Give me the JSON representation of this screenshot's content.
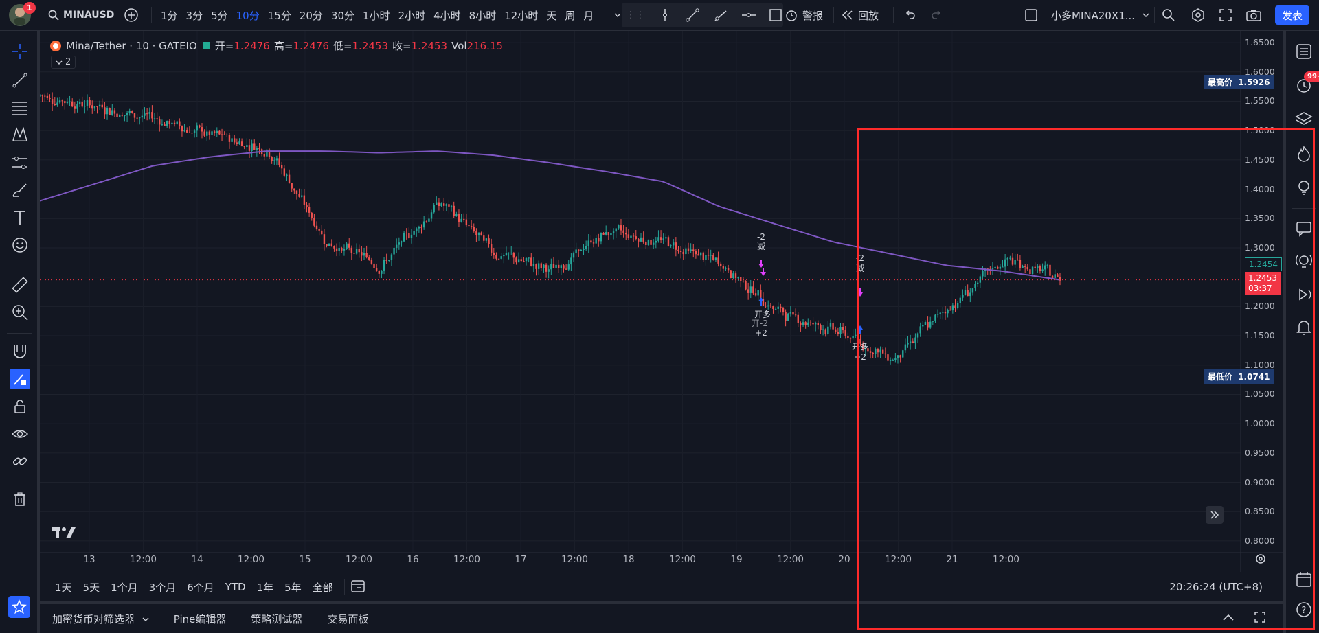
{
  "topbar": {
    "notif_count": "1",
    "symbol": "MINAUSD",
    "intervals": [
      "1分",
      "3分",
      "5分",
      "10分",
      "15分",
      "20分",
      "30分",
      "1小时",
      "2小时",
      "4小时",
      "8小时",
      "12小时",
      "天",
      "周",
      "月"
    ],
    "active_interval": "10分",
    "alert_label": "警报",
    "replay_label": "回放",
    "layout_name": "小多MINA20X1...",
    "publish_label": "发表"
  },
  "legend": {
    "title": "Mina/Tether · 10 · GATEIO",
    "open_label": "开=",
    "open": "1.2476",
    "high_label": "高=",
    "high": "1.2476",
    "low_label": "低=",
    "low": "1.2453",
    "close_label": "收=",
    "close": "1.2453",
    "vol_label": "Vol",
    "vol": "216.15",
    "indicator_count": "2"
  },
  "price_axis": {
    "ticks": [
      "1.6500",
      "1.6000",
      "1.5500",
      "1.5000",
      "1.4500",
      "1.4000",
      "1.3500",
      "1.3000",
      "1.2500",
      "1.2000",
      "1.1500",
      "1.1000",
      "1.0500",
      "1.0000",
      "0.9500",
      "0.9000",
      "0.8500",
      "0.8000"
    ],
    "high_label": "最高价",
    "high_value": "1.5926",
    "low_label": "最低价",
    "low_value": "1.0741",
    "ma_value": "1.2454",
    "last_price": "1.2453",
    "countdown": "03:37"
  },
  "time_axis": {
    "ticks": [
      "13",
      "12:00",
      "14",
      "12:00",
      "15",
      "12:00",
      "16",
      "12:00",
      "17",
      "12:00",
      "18",
      "12:00",
      "19",
      "12:00",
      "20",
      "12:00",
      "21",
      "12:00"
    ]
  },
  "signals": {
    "reduce_1_a": "-2",
    "reduce_1_b": "减",
    "open_1_a": "开多",
    "open_1_b": "开-2",
    "open_1_c": "+2",
    "reduce_2_a": "-2",
    "reduce_2_b": "减",
    "open_2_a": "开多",
    "open_2_b": "+2"
  },
  "bottom": {
    "ranges": [
      "1天",
      "5天",
      "1个月",
      "3个月",
      "6个月",
      "YTD",
      "1年",
      "5年",
      "全部"
    ],
    "clock": "20:26:24 (UTC+8)"
  },
  "panels": [
    "加密货币对筛选器",
    "Pine编辑器",
    "策略测试器",
    "交易面板"
  ],
  "right_badge": "99+",
  "colors": {
    "bg": "#131722",
    "up": "#26a69a",
    "down": "#ef5350",
    "ma": "#7e57c2",
    "accent": "#2962ff",
    "highlight": "#ff2b2b"
  },
  "chart_data": {
    "type": "candlestick",
    "symbol": "MINAUSD",
    "timeframe": "10分",
    "ylim": [
      0.78,
      1.67
    ],
    "x": [
      "13",
      "13 12:00",
      "14",
      "14 12:00",
      "15",
      "15 12:00",
      "16",
      "16 12:00",
      "17",
      "17 12:00",
      "18",
      "18 12:00",
      "19",
      "19 12:00",
      "20",
      "20 12:00",
      "21",
      "21 12:00",
      "21 now"
    ],
    "close_approx": [
      1.56,
      1.54,
      1.52,
      1.49,
      1.47,
      1.31,
      1.27,
      1.38,
      1.29,
      1.26,
      1.33,
      1.31,
      1.27,
      1.19,
      1.16,
      1.11,
      1.2,
      1.28,
      1.2453
    ],
    "ma_approx": [
      1.38,
      1.41,
      1.44,
      1.455,
      1.465,
      1.465,
      1.462,
      1.465,
      1.458,
      1.445,
      1.43,
      1.413,
      1.37,
      1.34,
      1.31,
      1.29,
      1.27,
      1.26,
      1.2454
    ],
    "high": 1.5926,
    "low": 1.0741
  }
}
